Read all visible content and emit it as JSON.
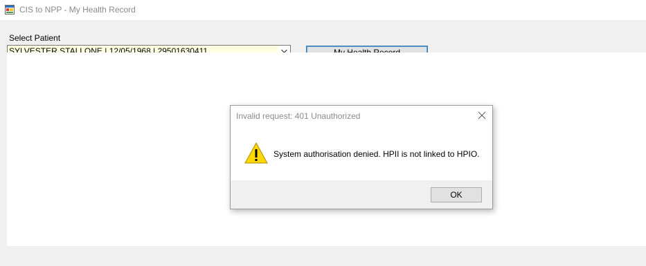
{
  "window": {
    "title": "CIS to NPP - My Health Record",
    "icon": "app-window-icon"
  },
  "form": {
    "select_label": "Select Patient",
    "patient_selected": "SYLVESTER STALLONE | 12/05/1968 | 29501630411",
    "my_health_record_button": "My Health Record"
  },
  "dialog": {
    "title": "Invalid request: 401 Unauthorized",
    "message": "System authorisation denied. HPII is not linked to HPIO.",
    "icon": "warning-icon",
    "ok_label": "OK"
  },
  "colors": {
    "combo_background": "#ffffe1",
    "button_focus_border": "#3c7fb1",
    "warning_yellow": "#ffd700"
  }
}
